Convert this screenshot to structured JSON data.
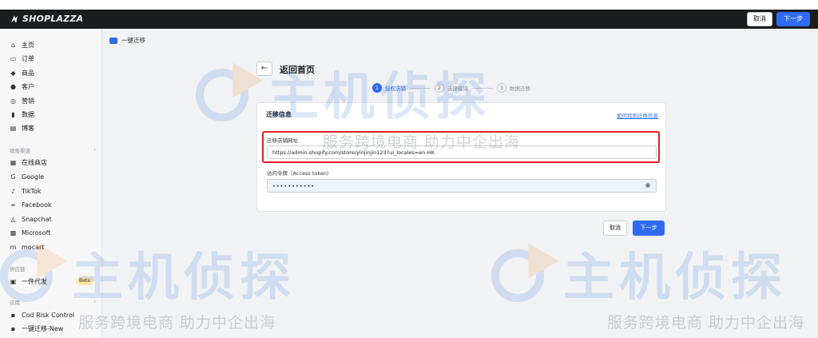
{
  "topbar": {
    "brand": "SHOPLAZZA",
    "cancel_label": "取消",
    "next_label": "下一步"
  },
  "sidebar": {
    "main_items": [
      {
        "label": "主页",
        "icon": "home-icon"
      },
      {
        "label": "订单",
        "icon": "inbox-icon"
      },
      {
        "label": "商品",
        "icon": "tag-icon"
      },
      {
        "label": "客户",
        "icon": "person-icon"
      },
      {
        "label": "营销",
        "icon": "target-icon"
      },
      {
        "label": "数据",
        "icon": "bar-chart-icon"
      },
      {
        "label": "博客",
        "icon": "blog-icon"
      }
    ],
    "channels_title": "销售渠道",
    "channel_items": [
      {
        "label": "在线商店",
        "icon": "store-icon"
      },
      {
        "label": "Google",
        "icon": "google-icon"
      },
      {
        "label": "TikTok",
        "icon": "tiktok-icon"
      },
      {
        "label": "Facebook",
        "icon": "facebook-icon"
      },
      {
        "label": "Snapchat",
        "icon": "snapchat-icon"
      },
      {
        "label": "Microsoft",
        "icon": "microsoft-icon"
      },
      {
        "label": "mocart",
        "icon": "mocart-icon"
      }
    ],
    "supply_title": "供应链",
    "supply_item": {
      "label": "一件代发",
      "badge": "Beta",
      "icon": "dropship-icon"
    },
    "apps_title": "应用",
    "app_items": [
      {
        "label": "Cod Risk Control",
        "icon": "app-icon"
      },
      {
        "label": "一键迁移-New",
        "icon": "app-icon"
      }
    ]
  },
  "main": {
    "breadcrumb": "一键迁移",
    "back_arrow": "←",
    "page_title": "返回首页",
    "steps": [
      {
        "num": "1",
        "label": "授权店铺",
        "active": true
      },
      {
        "num": "2",
        "label": "选择模块",
        "active": false
      },
      {
        "num": "3",
        "label": "数据迁移",
        "active": false
      }
    ],
    "card": {
      "title": "迁移信息",
      "help_link": "如何找到迁移信息",
      "store_url_label": "迁移店铺网址",
      "store_url_value": "https://admin.shopify.com/store/yinjinjin123?ui_locales=en-HK",
      "token_label": "访问令牌（Access token）",
      "token_value": "•••••••••••"
    },
    "cancel_label": "取消",
    "next_label": "下一步"
  },
  "watermark": {
    "logo_text": "主机侦探",
    "slogan": "服务跨境电商 助力中企出海"
  },
  "colors": {
    "accent": "#2f6bf2",
    "highlight": "#e02020",
    "topbar": "#1b1c1e"
  }
}
